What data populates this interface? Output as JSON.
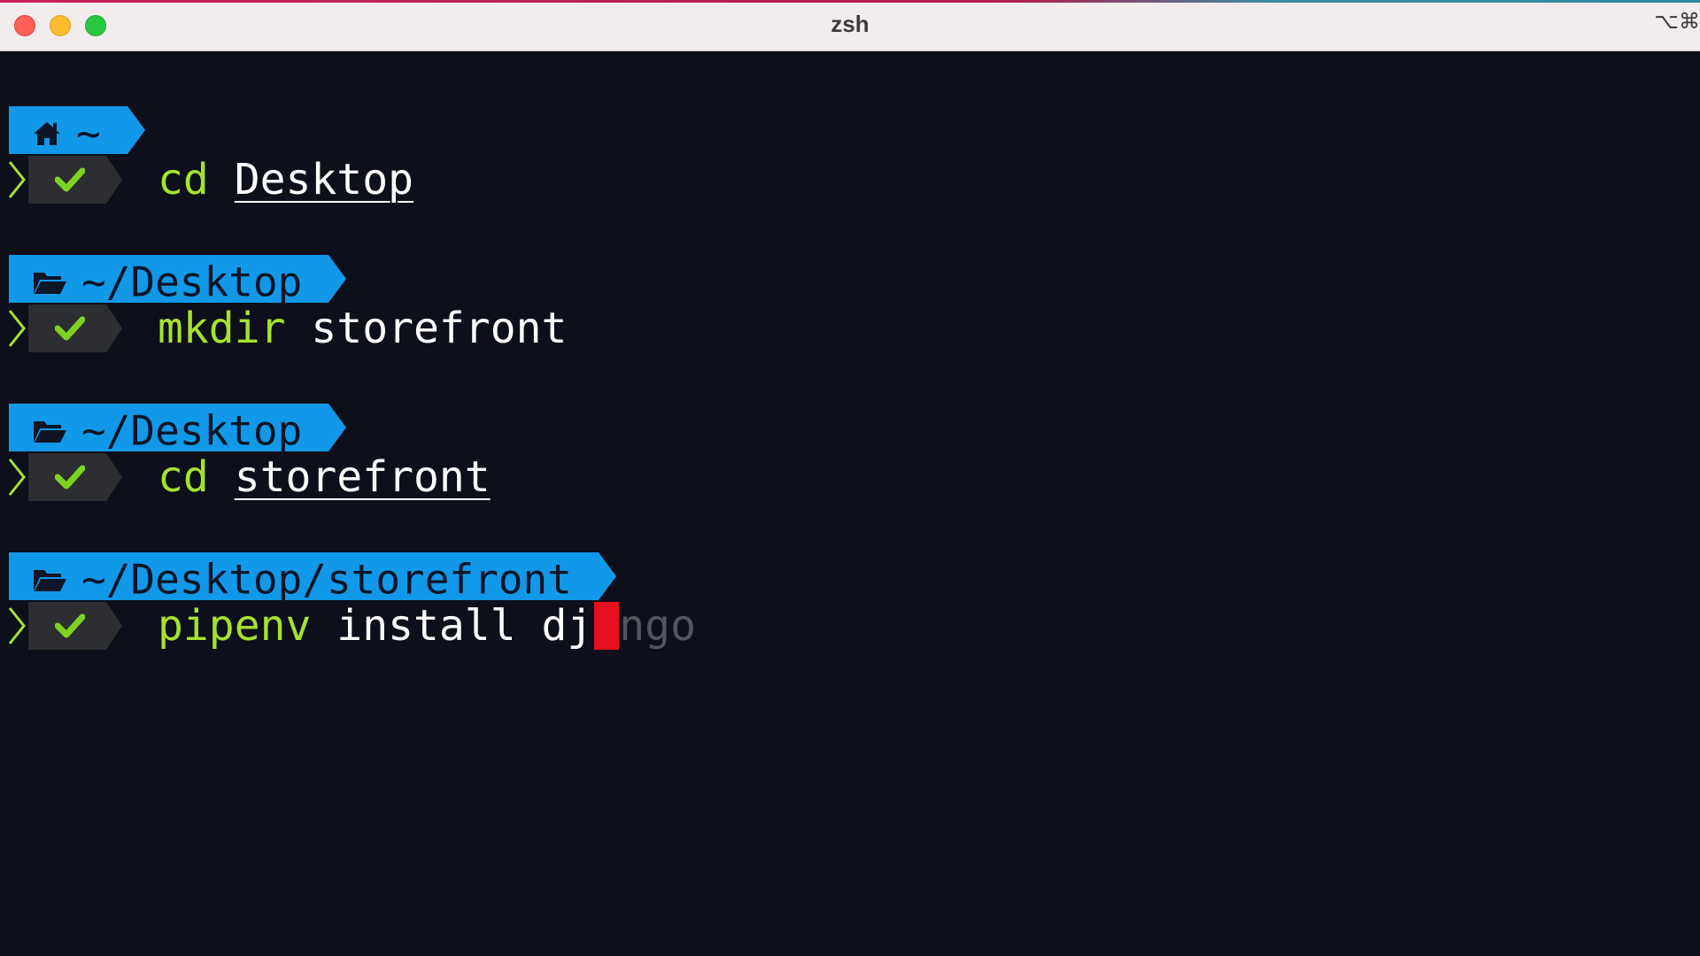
{
  "window": {
    "title": "zsh",
    "shortcut_hint": "⌥⌘"
  },
  "terminal": {
    "prompts": [
      {
        "path_icon": "home-icon",
        "path": "~",
        "status_icon": "check-icon",
        "command": {
          "verb": "cd",
          "args": "Desktop"
        }
      },
      {
        "path_icon": "folder-open-icon",
        "path": "~/Desktop",
        "status_icon": "check-icon",
        "command": {
          "verb": "mkdir",
          "args": "storefront"
        }
      },
      {
        "path_icon": "folder-open-icon",
        "path": "~/Desktop",
        "status_icon": "check-icon",
        "command": {
          "verb": "cd",
          "args": "storefront"
        }
      },
      {
        "path_icon": "folder-open-icon",
        "path": "~/Desktop/storefront",
        "status_icon": "check-icon",
        "command": {
          "verb": "pipenv",
          "args": "install dj",
          "autosuggestion": "ngo"
        }
      }
    ]
  },
  "colors": {
    "background": "#0d0f1a",
    "path_segment": "#1298e8",
    "status_segment": "#2c2e32",
    "command_verb": "#a6e22e",
    "check": "#7ed321",
    "cursor": "#e8101e",
    "autosuggestion": "#53565e"
  }
}
